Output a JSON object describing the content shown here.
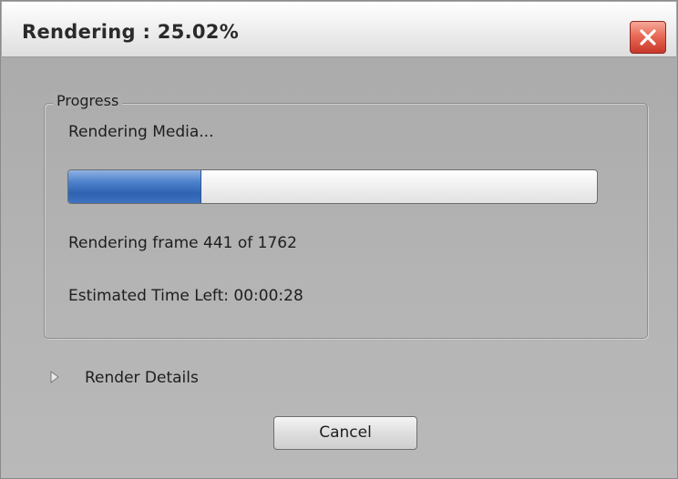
{
  "window": {
    "title": "Rendering : 25.02%",
    "close_icon": "close-x-icon"
  },
  "progress_group": {
    "legend": "Progress",
    "status_text": "Rendering Media...",
    "progress_fraction": 0.2502,
    "frame_text": "Rendering frame 441 of 1762",
    "time_left_text": "Estimated Time Left: 00:00:28"
  },
  "details": {
    "label": "Render Details",
    "icon": "disclosure-triangle-icon"
  },
  "buttons": {
    "cancel_label": "Cancel"
  },
  "colors": {
    "progress_fill": "#3f72c0",
    "close_button": "#e86a57"
  }
}
